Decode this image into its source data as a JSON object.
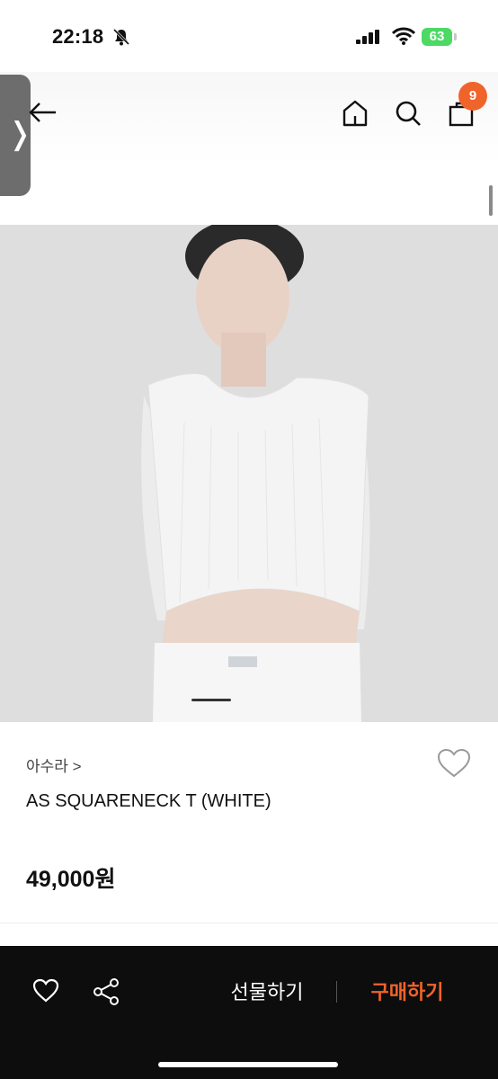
{
  "status": {
    "time": "22:18",
    "battery": "63"
  },
  "header": {
    "cart_count": "9",
    "side_tab_glyph": "❭"
  },
  "product": {
    "brand": "아수라 >",
    "title": "AS SQUARENECK T (WHITE)",
    "price": "49,000원"
  },
  "bottom_bar": {
    "gift_label": "선물하기",
    "buy_label": "구매하기"
  },
  "colors": {
    "accent": "#f0632b",
    "bottom_bar": "#0d0d0d",
    "battery": "#4cd964"
  },
  "icons": [
    "bell-slash-icon",
    "signal-icon",
    "wifi-icon",
    "back-arrow-icon",
    "home-icon",
    "search-icon",
    "shopping-bag-icon",
    "heart-icon",
    "share-icon"
  ]
}
